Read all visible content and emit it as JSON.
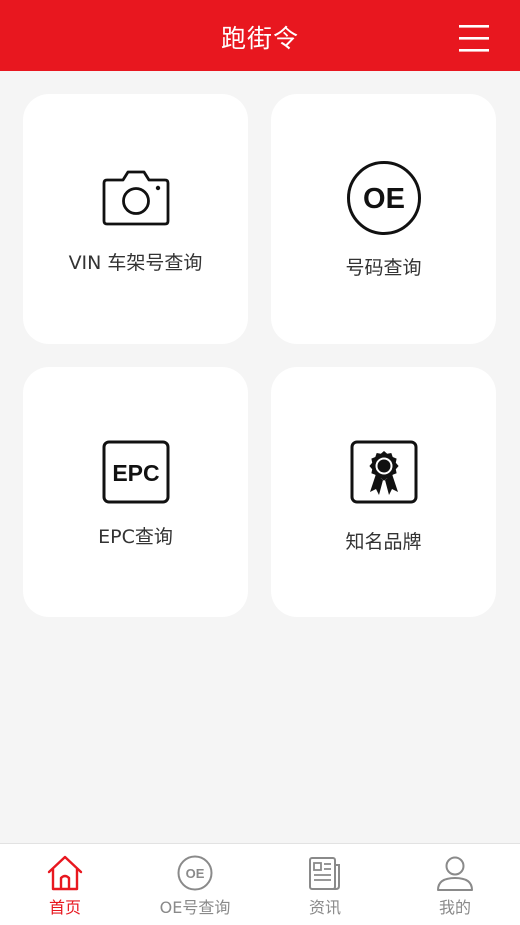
{
  "app": {
    "title": "跑街令"
  },
  "header": {
    "menu_icon": "hamburger-menu-icon",
    "background_color": "#e8171f"
  },
  "cards": [
    {
      "label": "VIN 车架号查询",
      "icon": "camera-icon"
    },
    {
      "label": "号码查询",
      "icon": "oe-circle-icon",
      "icon_text": "OE"
    },
    {
      "label": "EPC查询",
      "icon": "epc-box-icon",
      "icon_text": "EPC"
    },
    {
      "label": "知名品牌",
      "icon": "award-badge-icon"
    }
  ],
  "tabbar": {
    "active_color": "#e8171f",
    "inactive_color": "#8a8a8a",
    "tabs": [
      {
        "label": "首页",
        "icon": "home-icon",
        "active": true
      },
      {
        "label": "OE号查询",
        "icon": "oe-circle-icon",
        "icon_text": "OE",
        "active": false
      },
      {
        "label": "资讯",
        "icon": "news-icon",
        "active": false
      },
      {
        "label": "我的",
        "icon": "user-icon",
        "active": false
      }
    ]
  }
}
